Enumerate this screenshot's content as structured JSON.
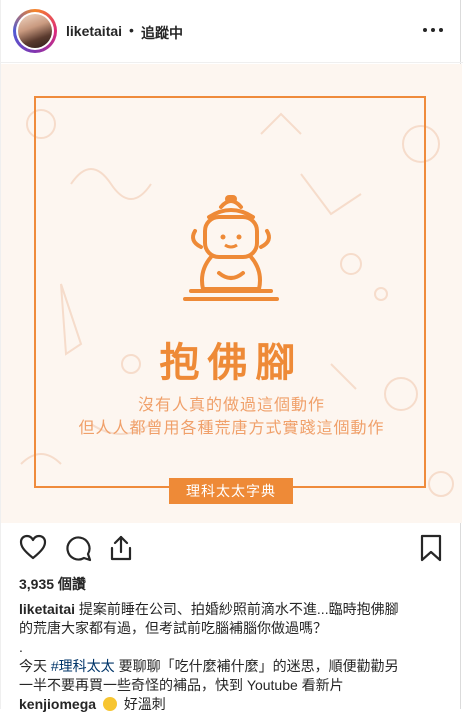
{
  "header": {
    "username": "liketaitai",
    "separator": "•",
    "follow_status": "追蹤中"
  },
  "post_image": {
    "title": "抱佛腳",
    "subtitle_line1": "沒有人真的做過這個動作",
    "subtitle_line2": "但人人都曾用各種荒唐方式實踐這個動作",
    "tag": "理科太太字典",
    "accent_color": "#ee8a37"
  },
  "actions": {
    "like_icon": "heart-icon",
    "comment_icon": "comment-icon",
    "share_icon": "share-icon",
    "save_icon": "bookmark-icon"
  },
  "likes": "3,935 個讚",
  "caption": {
    "username": "liketaitai",
    "line1": "提案前睡在公司、拍婚紗照前滴水不進...臨時抱佛腳",
    "line2": "的荒唐大家都有過，但考試前吃腦補腦你做過嗎？",
    "dot": ".",
    "line3_prefix": "今天 ",
    "hashtag": "#理科太太",
    "line3_suffix": " 要聊聊「吃什麼補什麼」的迷思，順便勸勸另",
    "line4": "一半不要再買一些奇怪的補品，快到 Youtube 看新片",
    "comment_user": "kenjiomega",
    "comment_text": "好溫刺"
  }
}
